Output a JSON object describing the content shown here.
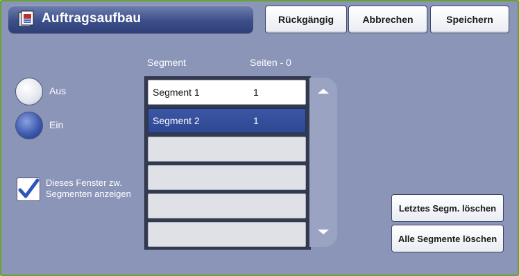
{
  "window": {
    "title": "Auftragsaufbau",
    "title_icon": "job-build-icon"
  },
  "toolbar": {
    "undo_label": "Rückgängig",
    "cancel_label": "Abbrechen",
    "save_label": "Speichern"
  },
  "table": {
    "col_segment": "Segment",
    "col_pages": "Seiten - 0",
    "rows": [
      {
        "segment": "Segment 1",
        "pages": "1"
      },
      {
        "segment": "Segment 2",
        "pages": "1"
      }
    ]
  },
  "options": {
    "off_label": "Aus",
    "on_label": "Ein",
    "selected": "Ein"
  },
  "checkbox": {
    "label_line1": "Dieses Fenster zw.",
    "label_line2": "Segmenten anzeigen",
    "checked": true
  },
  "actions": {
    "delete_last_label": "Letztes Segm. löschen",
    "delete_all_label": "Alle Segmente löschen"
  },
  "colors": {
    "background": "#8a95b8",
    "accent_border": "#66a52a",
    "selection": "#2f4893"
  }
}
